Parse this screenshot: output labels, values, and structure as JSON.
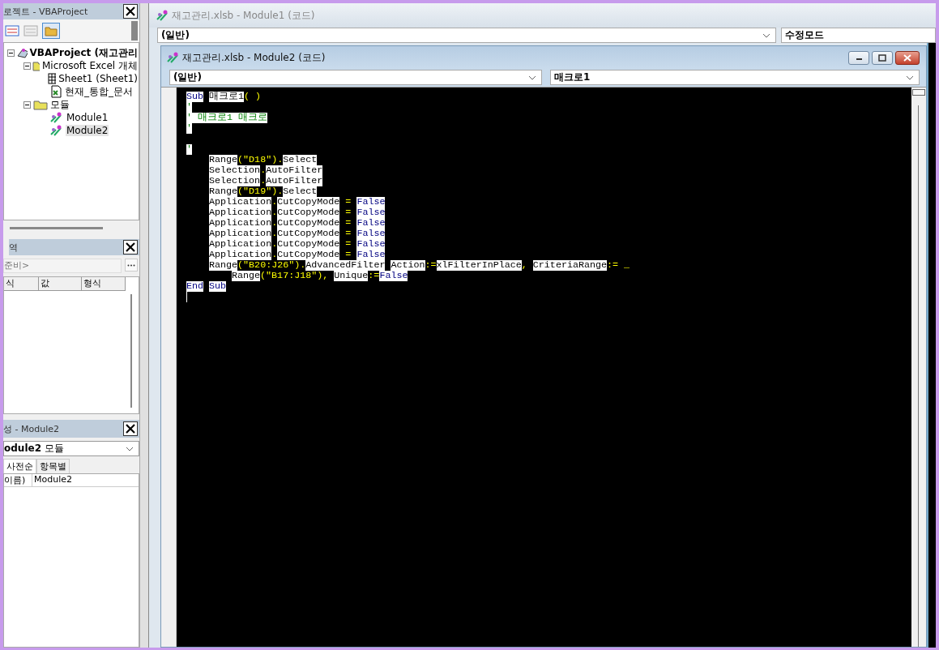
{
  "project_explorer": {
    "title": "로젝트 - VBAProject",
    "tree": [
      {
        "label": "VBAProject (재고관리",
        "kind": "project",
        "expanded": true,
        "selected": false,
        "children": [
          {
            "label": "Microsoft Excel 개체",
            "kind": "folder",
            "expanded": true,
            "selected": false,
            "children": [
              {
                "label": "Sheet1 (Sheet1)",
                "kind": "sheet",
                "selected": false
              },
              {
                "label": "현재_통합_문서",
                "kind": "workbook",
                "selected": false
              }
            ]
          },
          {
            "label": "모듈",
            "kind": "folder",
            "expanded": true,
            "selected": false,
            "children": [
              {
                "label": "Module1",
                "kind": "module",
                "selected": false
              },
              {
                "label": "Module2",
                "kind": "module",
                "selected": true
              }
            ]
          }
        ]
      }
    ]
  },
  "locals": {
    "title": "역",
    "context": "준비>",
    "columns": [
      "식",
      "값",
      "형식"
    ]
  },
  "properties": {
    "title": "성 - Module2",
    "object": "**odule2** 모듈",
    "tabs": [
      {
        "label": "사전순",
        "selected": true
      },
      {
        "label": "항목별",
        "selected": false
      }
    ],
    "rows": [
      {
        "name": "이름)",
        "value": "Module2"
      }
    ]
  },
  "back_window": {
    "title": "재고관리.xlsb - Module1 (코드)",
    "object": "(일반)",
    "procedure": "수정모드"
  },
  "code_window": {
    "title": "재고관리.xlsb - Module2 (코드)",
    "object": "(일반)",
    "procedure": "매크로1",
    "lines": [
      {
        "kind": "top",
        "tokens": [
          {
            "kind": "kw",
            "text": "Sub"
          },
          {
            "kind": "id",
            "text": "매크로1",
            "gap": true
          },
          {
            "kind": "op",
            "text": "( )"
          }
        ]
      },
      {
        "kind": "top",
        "tokens": [
          {
            "kind": "cm",
            "text": "'"
          }
        ]
      },
      {
        "kind": "top",
        "tokens": [
          {
            "kind": "cm",
            "text": "' 매크로1 매크로"
          }
        ]
      },
      {
        "kind": "top",
        "tokens": [
          {
            "kind": "cm",
            "text": "'"
          }
        ]
      },
      {
        "kind": "blank"
      },
      {
        "kind": "top",
        "tokens": [
          {
            "kind": "cm",
            "text": "'"
          }
        ]
      },
      {
        "kind": "body",
        "tokens": [
          {
            "kind": "id",
            "text": "Range"
          },
          {
            "kind": "op",
            "text": "(\"D18\")."
          },
          {
            "kind": "id",
            "text": "Select"
          }
        ]
      },
      {
        "kind": "body",
        "tokens": [
          {
            "kind": "id",
            "text": "Selection"
          },
          {
            "kind": "op",
            "text": "."
          },
          {
            "kind": "id",
            "text": "AutoFilter"
          }
        ]
      },
      {
        "kind": "body",
        "tokens": [
          {
            "kind": "id",
            "text": "Selection"
          },
          {
            "kind": "op",
            "text": "."
          },
          {
            "kind": "id",
            "text": "AutoFilter"
          }
        ]
      },
      {
        "kind": "body",
        "tokens": [
          {
            "kind": "id",
            "text": "Range"
          },
          {
            "kind": "op",
            "text": "(\"D19\")."
          },
          {
            "kind": "id",
            "text": "Select"
          }
        ]
      },
      {
        "kind": "body",
        "tokens": [
          {
            "kind": "id",
            "text": "Application"
          },
          {
            "kind": "op",
            "text": "."
          },
          {
            "kind": "id",
            "text": "CutCopyMode"
          },
          {
            "kind": "op",
            "text": " = "
          },
          {
            "kind": "kw",
            "text": "False"
          }
        ]
      },
      {
        "kind": "body",
        "tokens": [
          {
            "kind": "id",
            "text": "Application"
          },
          {
            "kind": "op",
            "text": "."
          },
          {
            "kind": "id",
            "text": "CutCopyMode"
          },
          {
            "kind": "op",
            "text": " = "
          },
          {
            "kind": "kw",
            "text": "False"
          }
        ]
      },
      {
        "kind": "body",
        "tokens": [
          {
            "kind": "id",
            "text": "Application"
          },
          {
            "kind": "op",
            "text": "."
          },
          {
            "kind": "id",
            "text": "CutCopyMode"
          },
          {
            "kind": "op",
            "text": " = "
          },
          {
            "kind": "kw",
            "text": "False"
          }
        ]
      },
      {
        "kind": "body",
        "tokens": [
          {
            "kind": "id",
            "text": "Application"
          },
          {
            "kind": "op",
            "text": "."
          },
          {
            "kind": "id",
            "text": "CutCopyMode"
          },
          {
            "kind": "op",
            "text": " = "
          },
          {
            "kind": "kw",
            "text": "False"
          }
        ]
      },
      {
        "kind": "body",
        "tokens": [
          {
            "kind": "id",
            "text": "Application"
          },
          {
            "kind": "op",
            "text": "."
          },
          {
            "kind": "id",
            "text": "CutCopyMode"
          },
          {
            "kind": "op",
            "text": " = "
          },
          {
            "kind": "kw",
            "text": "False"
          }
        ]
      },
      {
        "kind": "body",
        "tokens": [
          {
            "kind": "id",
            "text": "Application"
          },
          {
            "kind": "op",
            "text": "."
          },
          {
            "kind": "id",
            "text": "CutCopyMode"
          },
          {
            "kind": "op",
            "text": " = "
          },
          {
            "kind": "kw",
            "text": "False"
          }
        ]
      },
      {
        "kind": "body",
        "tokens": [
          {
            "kind": "id",
            "text": "Range"
          },
          {
            "kind": "op",
            "text": "(\"B20:J26\")."
          },
          {
            "kind": "id",
            "text": "AdvancedFilter"
          },
          {
            "kind": "id",
            "text": "Action",
            "gap": true
          },
          {
            "kind": "op",
            "text": ":="
          },
          {
            "kind": "id",
            "text": "xlFilterInPlace"
          },
          {
            "kind": "op",
            "text": ", "
          },
          {
            "kind": "id",
            "text": "CriteriaRange"
          },
          {
            "kind": "op",
            "text": ":= _"
          }
        ]
      },
      {
        "kind": "continuation",
        "tokens": [
          {
            "kind": "id",
            "text": "Range"
          },
          {
            "kind": "op",
            "text": "(\"B17:J18\"), "
          },
          {
            "kind": "id",
            "text": "Unique"
          },
          {
            "kind": "op",
            "text": ":="
          },
          {
            "kind": "kw",
            "text": "False"
          }
        ]
      },
      {
        "kind": "top",
        "tokens": [
          {
            "kind": "kw",
            "text": "End"
          },
          {
            "kind": "kw",
            "text": "Sub",
            "gap": true
          }
        ]
      },
      {
        "kind": "cursor"
      }
    ]
  }
}
